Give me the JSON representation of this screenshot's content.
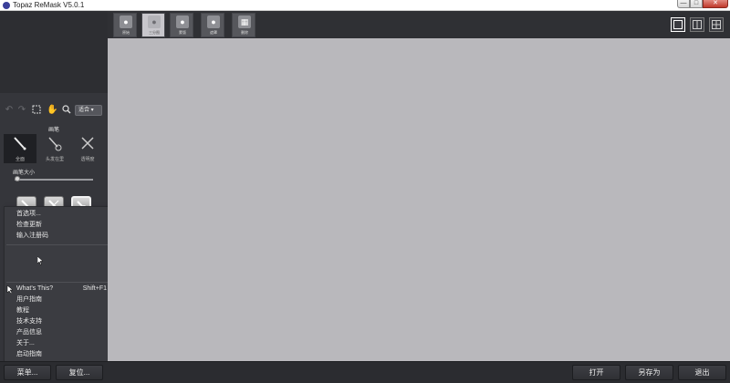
{
  "window": {
    "title": "Topaz ReMask V5.0.1",
    "min_label": "—",
    "max_label": "□",
    "close_label": "✕"
  },
  "toolbar": {
    "zoom_select": "适合 ▾"
  },
  "brush": {
    "title": "画笔",
    "modes": [
      {
        "label": "全面",
        "selected": true
      },
      {
        "label": "头发在里",
        "selected": false
      },
      {
        "label": "透明度",
        "selected": false
      }
    ],
    "size_label": "画笔大小",
    "size_value_percent": 4
  },
  "tabs": [
    {
      "label": "原始",
      "active": false
    },
    {
      "label": "三分图",
      "active": true
    },
    {
      "label": "蒙版",
      "active": false
    },
    {
      "label": "遮罩",
      "active": false
    },
    {
      "label": "删除",
      "active": false
    }
  ],
  "menu": {
    "items_top": [
      "首选项...",
      "检查更新",
      "输入注册码"
    ],
    "disabled_items": [
      "",
      "",
      "",
      ""
    ],
    "whats_this": {
      "label": "What's This?",
      "shortcut": "Shift+F1"
    },
    "items_bottom": [
      "用户指南",
      "教程",
      "技术支持",
      "产品信息",
      "关于...",
      "启动指南"
    ]
  },
  "bottom": {
    "menu_button": "菜单...",
    "reset_button": "复位...",
    "open_button": "打开",
    "save_as_button": "另存为",
    "exit_button": "退出"
  },
  "colors": {
    "canvas": "#b9b8bc",
    "panel": "#35363b",
    "menu": "#3b3c41",
    "close": "#c0392b"
  }
}
